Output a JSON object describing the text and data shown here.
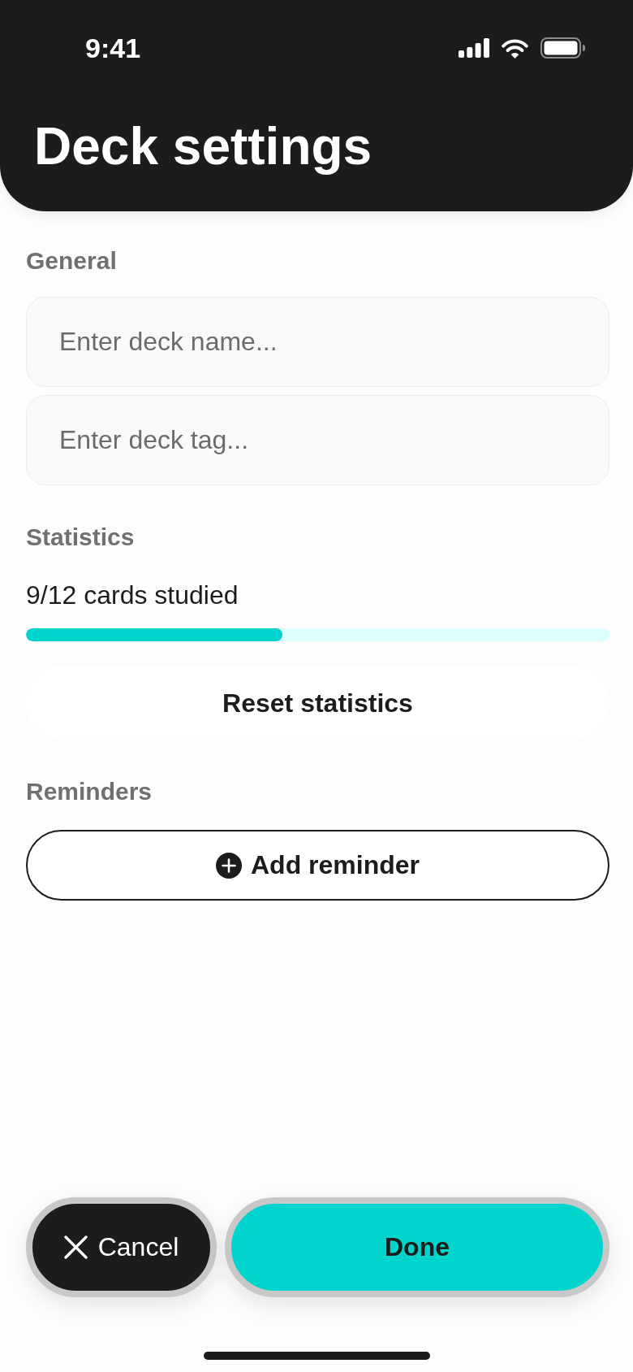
{
  "status_bar": {
    "time": "9:41"
  },
  "header": {
    "title": "Deck settings"
  },
  "sections": [
    {
      "kind": "fields",
      "title": "General",
      "fields": [
        {
          "placeholder": "Enter deck name..."
        },
        {
          "placeholder": "Enter deck tag..."
        }
      ]
    },
    {
      "kind": "progress",
      "title": "Statistics",
      "progress": {
        "label": "9/12 cards studied",
        "level": 0.44
      },
      "button": "Reset statistics"
    },
    {
      "kind": "add",
      "title": "Reminders",
      "button": "Add reminder"
    }
  ],
  "actions": [
    {
      "kind": "cancel",
      "label": "Cancel"
    },
    {
      "kind": "done",
      "label": "Done"
    }
  ]
}
